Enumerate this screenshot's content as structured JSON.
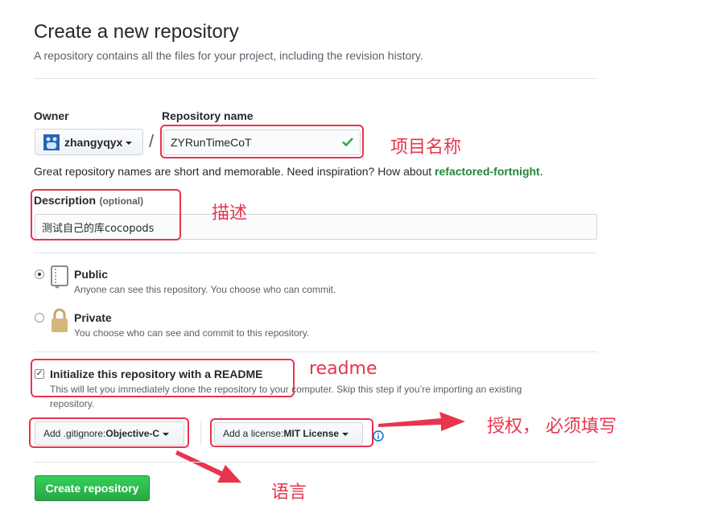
{
  "header": {
    "title": "Create a new repository",
    "subtitle": "A repository contains all the files for your project, including the revision history."
  },
  "owner": {
    "label": "Owner",
    "value": "zhangyqyx"
  },
  "repo_name": {
    "label": "Repository name",
    "separator": "/",
    "value": "ZYRunTimeCoT"
  },
  "hint": {
    "prefix": "Great repository names are short and memorable. Need inspiration? How about ",
    "suggestion": "refactored-fortnight",
    "suffix": "."
  },
  "description": {
    "label": "Description",
    "optional": "(optional)",
    "value": "测试自己的库cocopods"
  },
  "visibility": {
    "public": {
      "title": "Public",
      "desc": "Anyone can see this repository. You choose who can commit.",
      "selected": true
    },
    "private": {
      "title": "Private",
      "desc": "You choose who can see and commit to this repository.",
      "selected": false
    }
  },
  "readme": {
    "title": "Initialize this repository with a README",
    "desc_line1": "This will let you immediately clone the repository to your computer. Skip this step if you’re importing an existing",
    "desc_line2": "repository.",
    "checked": true
  },
  "gitignore": {
    "prefix": "Add .gitignore: ",
    "value": "Objective-C"
  },
  "license": {
    "prefix": "Add a license: ",
    "value": "MIT License"
  },
  "submit": {
    "label": "Create repository"
  },
  "annotations": {
    "repo_name": "项目名称",
    "description": "描述",
    "readme": "readme",
    "license": "授权， 必须填写",
    "language": "语言"
  },
  "colors": {
    "annotation": "#e8344e",
    "primary": "#28a745",
    "suggestion": "#22863a"
  }
}
